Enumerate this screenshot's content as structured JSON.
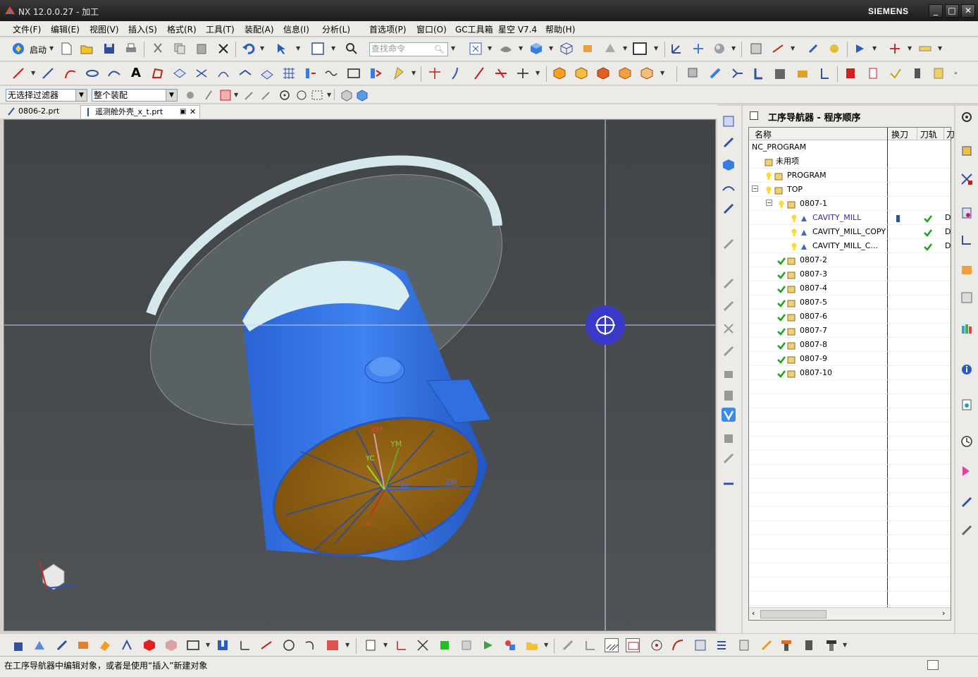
{
  "window": {
    "title": "NX 12.0.0.27 - 加工",
    "brand": "SIEMENS"
  },
  "menu": [
    "文件(F)",
    "编辑(E)",
    "视图(V)",
    "插入(S)",
    "格式(R)",
    "工具(T)",
    "装配(A)",
    "信息(I)",
    "分析(L)",
    "首选项(P)",
    "窗口(O)",
    "GC工具箱",
    "星空 V7.4",
    "帮助(H)"
  ],
  "toolbar": {
    "start_label": "启动",
    "search_placeholder": "查找命令"
  },
  "selection": {
    "filter": "无选择过滤器",
    "scope": "整个装配"
  },
  "tabs": [
    "0806-2.prt",
    "遥测舱外壳_x_t.prt"
  ],
  "navigator": {
    "title": "工序导航器 - 程序顺序",
    "columns": [
      "名称",
      "换刀",
      "刀轨",
      "刀"
    ],
    "rows": [
      {
        "label": "NC_PROGRAM"
      },
      {
        "label": "未用项"
      },
      {
        "label": "PROGRAM"
      },
      {
        "label": "TOP"
      },
      {
        "label": "0807-1"
      },
      {
        "label": "CAVITY_MILL",
        "col3": "D"
      },
      {
        "label": "CAVITY_MILL_COPY",
        "col3": "D"
      },
      {
        "label": "CAVITY_MILL_C...",
        "col3": "D"
      },
      {
        "label": "0807-2"
      },
      {
        "label": "0807-3"
      },
      {
        "label": "0807-4"
      },
      {
        "label": "0807-5"
      },
      {
        "label": "0807-6"
      },
      {
        "label": "0807-7"
      },
      {
        "label": "0807-8"
      },
      {
        "label": "0807-9"
      },
      {
        "label": "0807-10"
      }
    ]
  },
  "viewport": {
    "csys_labels": {
      "xm": "XM",
      "ym": "YM",
      "zm": "ZM",
      "yc": "YC",
      "zc": "ZC",
      "xc": "XC"
    }
  },
  "status": {
    "message": "在工序导航器中编辑对象，或者是使用“插入”新建对象"
  },
  "colors": {
    "part_blue": "#2f6fe0",
    "face_brown": "#8a5a12",
    "check_green": "#1aa31a",
    "selected_text": "#3a2aa0"
  }
}
